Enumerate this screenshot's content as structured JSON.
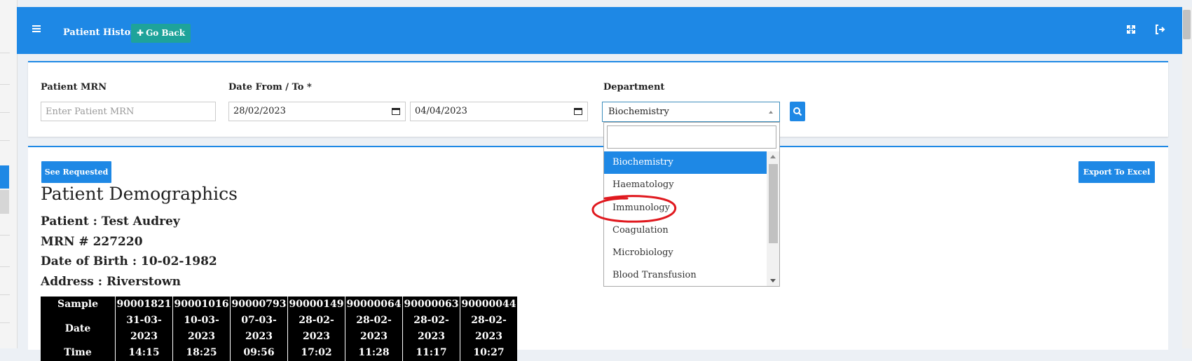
{
  "header": {
    "title": "Patient History",
    "go_back_label": "Go Back",
    "go_back_icon": "plus-icon",
    "menu_icon": "hamburger-icon",
    "expand_icon": "fullscreen-icon",
    "logout_icon": "sign-out-icon",
    "accent_color": "#1e88e5",
    "go_back_color": "#1ea39a"
  },
  "filters": {
    "mrn_label": "Patient MRN",
    "mrn_placeholder": "Enter Patient MRN",
    "mrn_value": "",
    "date_label": "Date From / To *",
    "date_from": "28/02/2023",
    "date_to": "04/04/2023",
    "department_label": "Department",
    "department_value": "Biochemistry",
    "search_icon": "search-icon"
  },
  "department_dropdown": {
    "search_value": "",
    "options": [
      "Biochemistry",
      "Haematology",
      "Immunology",
      "Coagulation",
      "Microbiology",
      "Blood Transfusion"
    ],
    "highlighted": "Biochemistry",
    "circled": "Immunology",
    "annotation_color": "#e0191f"
  },
  "actions": {
    "see_requested": "See Requested",
    "export_excel": "Export To Excel"
  },
  "demographics": {
    "title": "Patient Demographics",
    "patient": "Patient : Test Audrey",
    "mrn": "MRN # 227220",
    "dob": "Date of Birth : 10-02-1982",
    "address": "Address : Riverstown"
  },
  "results_table": {
    "row_headers": [
      "Sample",
      "Date",
      "Time"
    ],
    "columns": [
      {
        "sample": "90001821",
        "date": "31-03-2023",
        "time": "14:15"
      },
      {
        "sample": "90001016",
        "date": "10-03-2023",
        "time": "18:25"
      },
      {
        "sample": "90000793",
        "date": "07-03-2023",
        "time": "09:56"
      },
      {
        "sample": "90000149",
        "date": "28-02-2023",
        "time": "17:02"
      },
      {
        "sample": "90000064",
        "date": "28-02-2023",
        "time": "11:28"
      },
      {
        "sample": "90000063",
        "date": "28-02-2023",
        "time": "11:17"
      },
      {
        "sample": "90000044",
        "date": "28-02-2023",
        "time": "10:27"
      }
    ]
  }
}
